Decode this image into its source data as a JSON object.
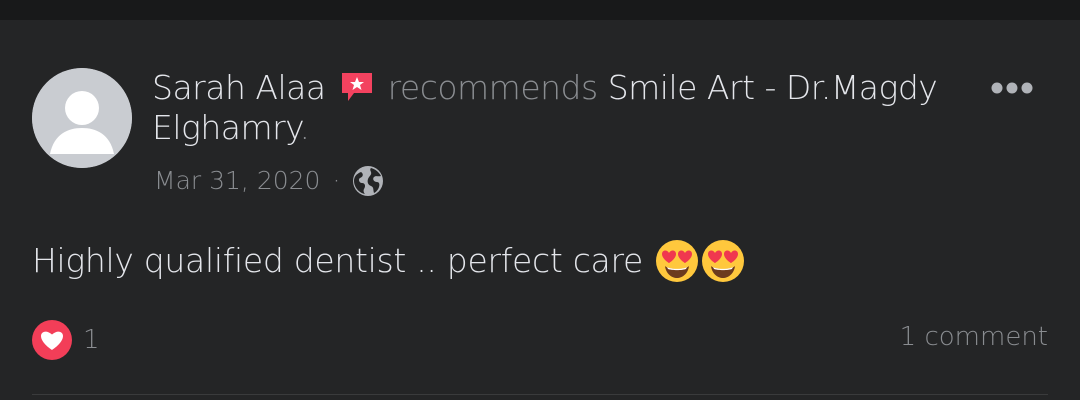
{
  "post": {
    "author": "Sarah Alaa",
    "action": "recommends",
    "page_name": "Smile Art - Dr.Magdy Elghamry",
    "period": ".",
    "date": "Mar 31, 2020",
    "separator": "·",
    "text": "Highly qualified dentist .. perfect care",
    "reaction_count": "1",
    "comments_label": "1 comment"
  },
  "icons": {
    "badge": "recommendation-badge-icon",
    "globe": "globe-icon",
    "more": "more-options-icon",
    "emoji": "heart-eyes-emoji",
    "love": "love-reaction-icon"
  },
  "colors": {
    "background": "#242526",
    "text_primary": "#e4e6eb",
    "text_secondary": "#8a8d91",
    "badge": "#f3425f",
    "love": "#f33e58"
  }
}
